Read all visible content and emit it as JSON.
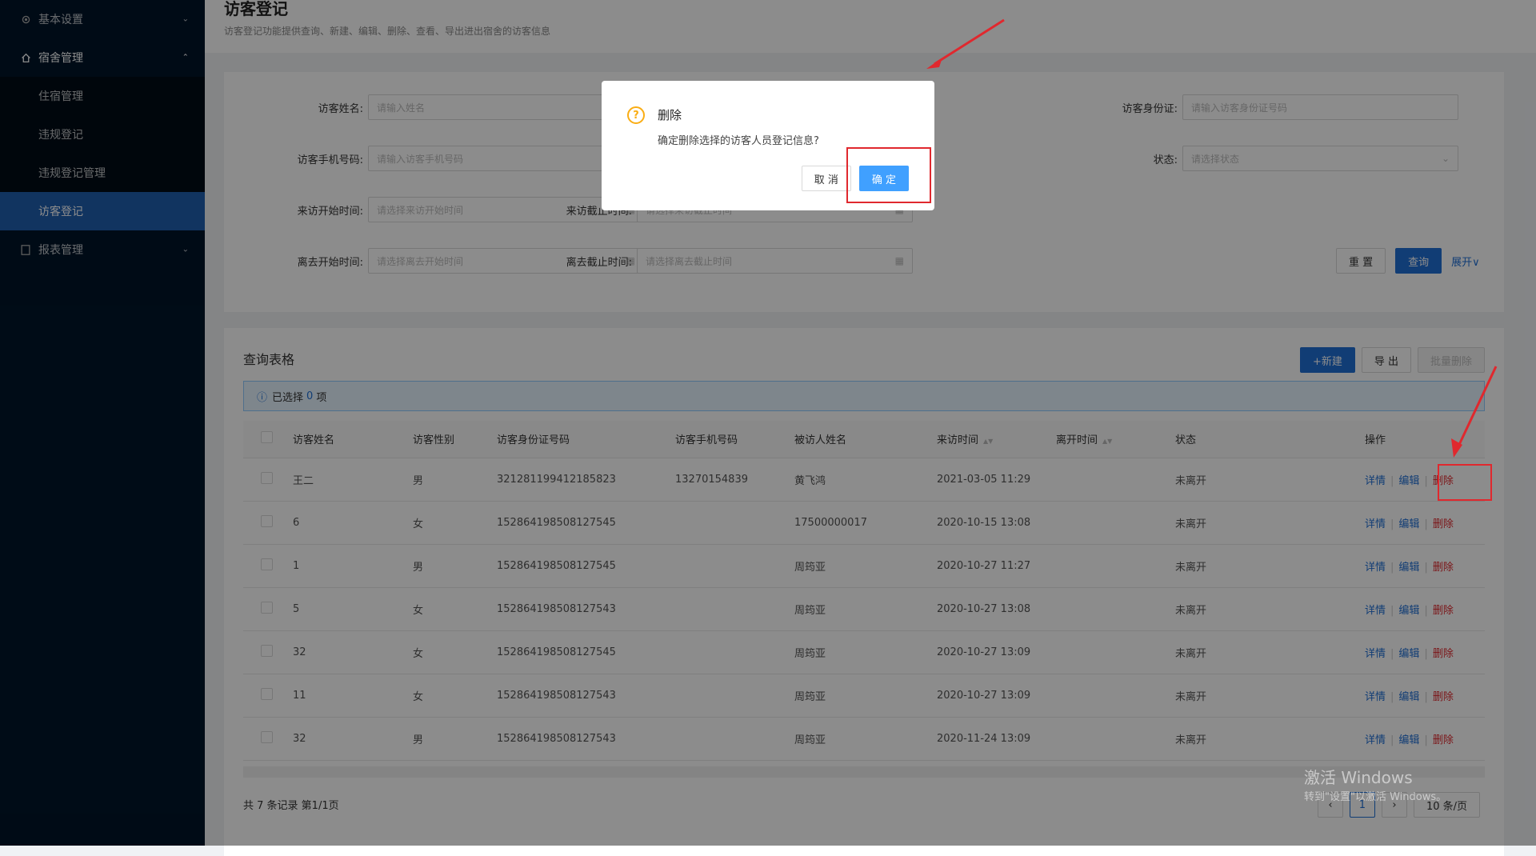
{
  "sidebar": {
    "items": [
      {
        "label": "基本设置",
        "icon": "gear-icon",
        "arrow": "⌄"
      },
      {
        "label": "宿舍管理",
        "icon": "home-icon",
        "arrow": "⌃"
      },
      {
        "label": "报表管理",
        "icon": "report-icon",
        "arrow": "⌄"
      }
    ],
    "sub": [
      "住宿管理",
      "违规登记",
      "违规登记管理",
      "访客登记"
    ]
  },
  "page": {
    "title": "访客登记",
    "desc": "访客登记功能提供查询、新建、编辑、删除、查看、导出进出宿舍的访客信息"
  },
  "form": {
    "name_label": "访客姓名:",
    "name_ph": "请输入姓名",
    "id_label": "访客身份证:",
    "id_ph": "请输入访客身份证号码",
    "phone_label": "访客手机号码:",
    "phone_ph": "请输入访客手机号码",
    "status_label": "状态:",
    "status_ph": "请选择状态",
    "start_label": "来访开始时间:",
    "start_ph": "请选择来访开始时间",
    "end_label": "来访截止时间:",
    "end_ph": "请选择来访截止时间",
    "leave_start_label": "离去开始时间:",
    "leave_start_ph": "请选择离去开始时间",
    "leave_end_label": "离去截止时间:",
    "leave_end_ph": "请选择离去截止时间",
    "reset": "重 置",
    "query": "查询",
    "expand": "展开∨"
  },
  "table": {
    "title": "查询表格",
    "new": "+新建",
    "export": "导 出",
    "batch_delete": "批量删除",
    "selected_prefix": "已选择",
    "selected_count": "0",
    "selected_suffix": "项",
    "headers": [
      "访客姓名",
      "访客性别",
      "访客身份证号码",
      "访客手机号码",
      "被访人姓名",
      "来访时间",
      "离开时间",
      "状态",
      "操作"
    ],
    "rows": [
      [
        "王二",
        "男",
        "321281199412185823",
        "13270154839",
        "黄飞鸿",
        "2021-03-05 11:29",
        "",
        "未离开"
      ],
      [
        "6",
        "女",
        "152864198508127545",
        "",
        "17500000017",
        "2020-10-15 13:08",
        "",
        "未离开"
      ],
      [
        "1",
        "男",
        "152864198508127545",
        "",
        "周筠亚",
        "2020-10-27 11:27",
        "",
        "未离开"
      ],
      [
        "5",
        "女",
        "152864198508127543",
        "",
        "周筠亚",
        "2020-10-27 13:08",
        "",
        "未离开"
      ],
      [
        "32",
        "女",
        "152864198508127545",
        "",
        "周筠亚",
        "2020-10-27 13:09",
        "",
        "未离开"
      ],
      [
        "11",
        "女",
        "152864198508127543",
        "",
        "周筠亚",
        "2020-10-27 13:09",
        "",
        "未离开"
      ],
      [
        "32",
        "男",
        "152864198508127543",
        "",
        "周筠亚",
        "2020-11-24 13:09",
        "",
        "未离开"
      ]
    ],
    "ops": {
      "detail": "详情",
      "edit": "编辑",
      "delete": "删除"
    },
    "total": "共 7 条记录 第1/1页",
    "page": "1",
    "page_size": "10 条/页"
  },
  "modal": {
    "title": "删除",
    "content": "确定删除选择的访客人员登记信息?",
    "cancel": "取 消",
    "ok": "确 定"
  },
  "watermark": {
    "line1": "激活 Windows",
    "line2": "转到\"设置\"以激活 Windows。"
  }
}
